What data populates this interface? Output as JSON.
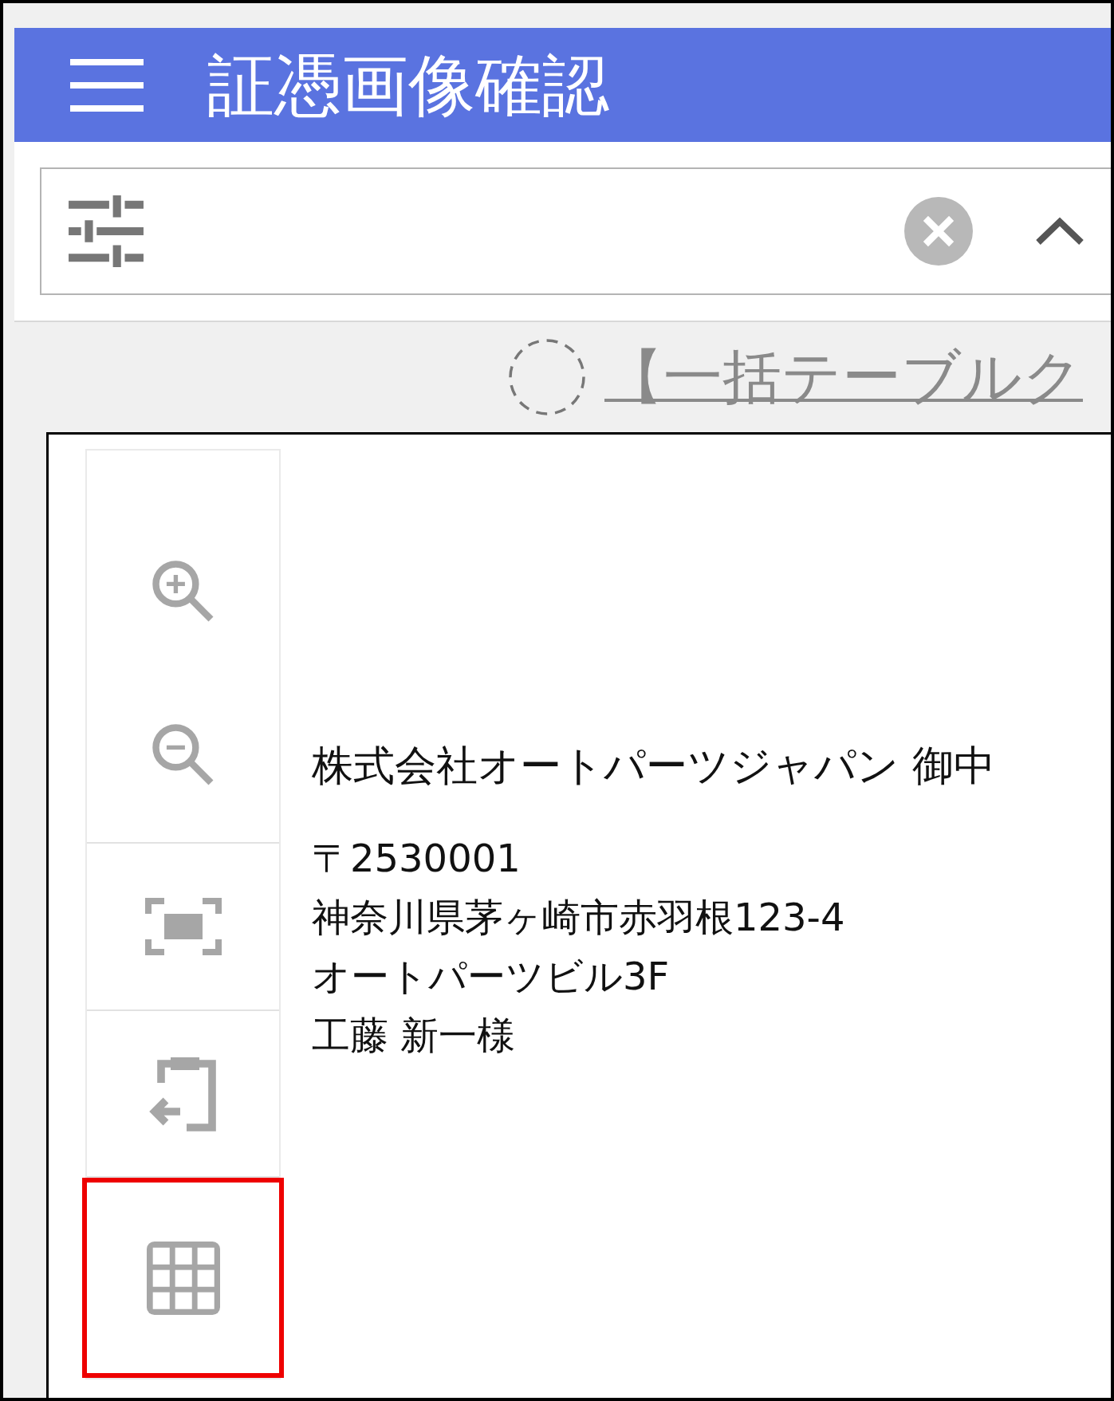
{
  "header": {
    "title": "証憑画像確認"
  },
  "link": {
    "text": "【一括テーブルク"
  },
  "document": {
    "lines": [
      {
        "kind": "addressee",
        "text": "株式会社オートパーツジャパン 御中"
      },
      {
        "kind": "address",
        "text": "〒2530001"
      },
      {
        "kind": "address",
        "text": "神奈川県茅ヶ崎市赤羽根123-4"
      },
      {
        "kind": "address",
        "text": "オートパーツビル3F"
      },
      {
        "kind": "address",
        "text": "工藤 新一様"
      }
    ]
  },
  "tool_groups": [
    {
      "tools": [
        {
          "kind": "zoom-in",
          "selected": false
        },
        {
          "kind": "zoom-out",
          "selected": false
        }
      ]
    },
    {
      "tools": [
        {
          "kind": "fit",
          "selected": false
        }
      ]
    },
    {
      "tools": [
        {
          "kind": "export",
          "selected": false
        }
      ]
    },
    {
      "tools": [
        {
          "kind": "grid",
          "selected": true
        }
      ]
    }
  ]
}
